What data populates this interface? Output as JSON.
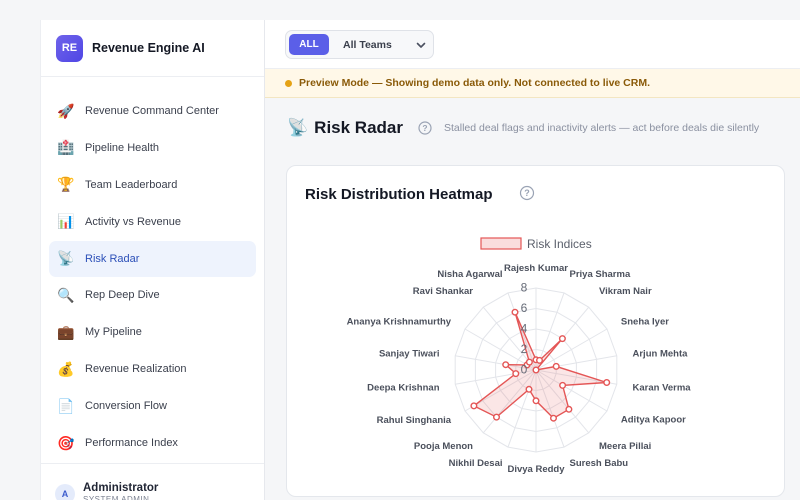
{
  "brand": {
    "badge": "RE",
    "name": "Revenue Engine AI"
  },
  "nav": [
    {
      "label": "Revenue Command Center",
      "icon": "🚀",
      "icon_name": "rocket-icon",
      "active": false
    },
    {
      "label": "Pipeline Health",
      "icon": "🏥",
      "icon_name": "hospital-icon",
      "active": false
    },
    {
      "label": "Team Leaderboard",
      "icon": "🏆",
      "icon_name": "trophy-icon",
      "active": false
    },
    {
      "label": "Activity vs Revenue",
      "icon": "📊",
      "icon_name": "bar-chart-icon",
      "active": false
    },
    {
      "label": "Risk Radar",
      "icon": "📡",
      "icon_name": "satellite-dish-icon",
      "active": true
    },
    {
      "label": "Rep Deep Dive",
      "icon": "🔍",
      "icon_name": "magnifier-icon",
      "active": false
    },
    {
      "label": "My Pipeline",
      "icon": "💼",
      "icon_name": "briefcase-icon",
      "active": false
    },
    {
      "label": "Revenue Realization",
      "icon": "💰",
      "icon_name": "money-bag-icon",
      "active": false
    },
    {
      "label": "Conversion Flow",
      "icon": "📄",
      "icon_name": "document-icon",
      "active": false
    },
    {
      "label": "Performance Index",
      "icon": "🎯",
      "icon_name": "target-icon",
      "active": false
    }
  ],
  "user": {
    "initial": "A",
    "name": "Administrator",
    "role": "SYSTEM ADMIN"
  },
  "filters": {
    "all_label": "ALL",
    "team_select": "All Teams"
  },
  "banner": {
    "text": "Preview Mode — Showing demo data only. Not connected to live CRM."
  },
  "page": {
    "icon": "📡",
    "title": "Risk Radar",
    "subtitle": "Stalled deal flags and inactivity alerts — act before deals die silently"
  },
  "card": {
    "title": "Risk Distribution Heatmap"
  },
  "colors": {
    "accent": "#5b5fe8",
    "series": "#e45656",
    "warning": "#e5a214"
  },
  "chart_data": {
    "type": "radar",
    "legend": [
      "Risk Indices"
    ],
    "legend_position": "top",
    "rlim": [
      0,
      8
    ],
    "ticks": [
      0,
      2,
      4,
      6,
      8
    ],
    "categories": [
      "Rajesh Kumar",
      "Priya Sharma",
      "Vikram Nair",
      "Sneha Iyer",
      "Arjun Mehta",
      "Karan Verma",
      "Aditya Kapoor",
      "Meera Pillai",
      "Suresh Babu",
      "Divya Reddy",
      "Nikhil Desai",
      "Pooja Menon",
      "Rahul Singhania",
      "Deepa Krishnan",
      "Sanjay Tiwari",
      "Ananya Krishnamurthy",
      "Ravi Shankar",
      "Nisha Agarwal"
    ],
    "series": [
      {
        "name": "Risk Indices",
        "values": [
          1,
          1,
          4,
          0,
          2,
          7,
          3,
          5,
          5,
          3,
          2,
          6,
          7,
          2,
          3,
          1,
          1,
          6
        ]
      }
    ]
  }
}
